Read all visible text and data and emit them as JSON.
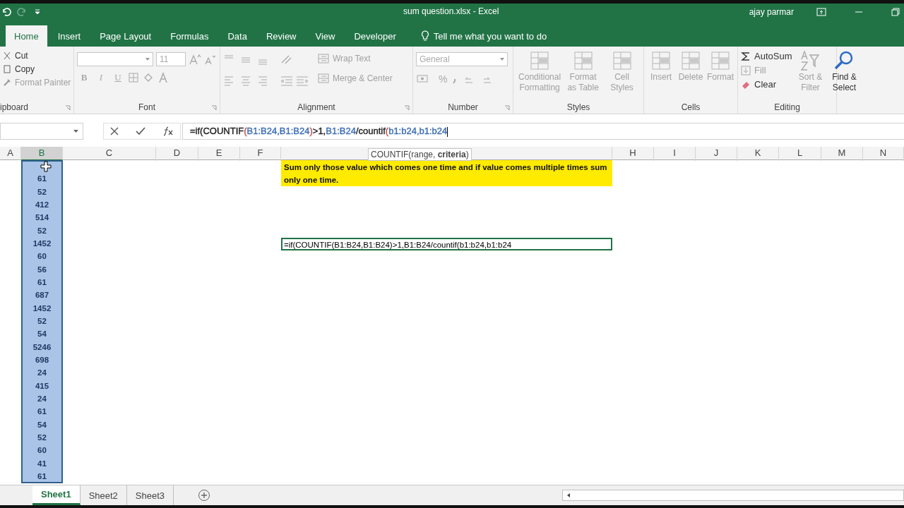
{
  "window": {
    "title": "sum question.xlsx  -  Excel",
    "user": "ajay parmar"
  },
  "ribbon_tabs": [
    {
      "label": "Home",
      "selected": true
    },
    {
      "label": "Insert",
      "selected": false
    },
    {
      "label": "Page Layout",
      "selected": false
    },
    {
      "label": "Formulas",
      "selected": false
    },
    {
      "label": "Data",
      "selected": false
    },
    {
      "label": "Review",
      "selected": false
    },
    {
      "label": "View",
      "selected": false
    },
    {
      "label": "Developer",
      "selected": false
    }
  ],
  "tell_me": "Tell me what you want to do",
  "ribbon": [
    {
      "kind": "clipboard",
      "label": "ipboard",
      "items": [
        {
          "label": "Cut",
          "disabled": false
        },
        {
          "label": "Copy",
          "disabled": false
        },
        {
          "label": "Format Painter",
          "disabled": true
        }
      ]
    },
    {
      "kind": "font",
      "label": "Font",
      "font_size": "11",
      "buttons": [
        "B",
        "I",
        "U"
      ],
      "disabled": true
    },
    {
      "kind": "alignment",
      "label": "Alignment",
      "items": [
        {
          "label": "Wrap Text",
          "disabled": true
        },
        {
          "label": "Merge & Center",
          "disabled": true
        }
      ]
    },
    {
      "kind": "number",
      "label": "Number",
      "format": "General",
      "percent": "%",
      "disabled": true
    },
    {
      "kind": "large",
      "label": "Styles",
      "items": [
        {
          "label": "Conditional Formatting",
          "disabled": true
        },
        {
          "label": "Format as Table",
          "disabled": true
        },
        {
          "label": "Cell Styles",
          "disabled": true
        }
      ]
    },
    {
      "kind": "large",
      "label": "Cells",
      "items": [
        {
          "label": "Insert",
          "disabled": true
        },
        {
          "label": "Delete",
          "disabled": true
        },
        {
          "label": "Format",
          "disabled": true
        }
      ]
    },
    {
      "kind": "editing",
      "label": "Editing",
      "items": [
        {
          "label": "AutoSum",
          "disabled": false
        },
        {
          "label": "Fill",
          "disabled": true
        },
        {
          "label": "Clear",
          "disabled": false
        }
      ],
      "large": [
        {
          "label": "Sort & Filter",
          "disabled": true
        },
        {
          "label": "Find & Select",
          "disabled": false
        }
      ]
    }
  ],
  "formula": [
    {
      "text": "=if(COUNTIF",
      "color": "#222222"
    },
    {
      "text": "(",
      "color": "#c0504d"
    },
    {
      "text": "B1:B24,B1:B24",
      "color": "#3f6fb5"
    },
    {
      "text": ")",
      "color": "#c0504d"
    },
    {
      "text": ">1,",
      "color": "#222222"
    },
    {
      "text": "B1:B24",
      "color": "#3f6fb5"
    },
    {
      "text": "/countif",
      "color": "#222222"
    },
    {
      "text": "(",
      "color": "#c0504d"
    },
    {
      "text": "b1:b24,b1:b24",
      "color": "#3f6fb5"
    }
  ],
  "tooltip": "COUNTIF(range, **criteria**)",
  "columns": [
    {
      "label": "A",
      "selected": false
    },
    {
      "label": "B",
      "selected": true
    },
    {
      "label": "C",
      "selected": false
    },
    {
      "label": "D",
      "selected": false
    },
    {
      "label": "E",
      "selected": false
    },
    {
      "label": "F",
      "selected": false
    },
    {
      "selected": false
    },
    {
      "label": "H",
      "selected": false
    },
    {
      "label": "I",
      "selected": false
    },
    {
      "label": "J",
      "selected": false
    },
    {
      "label": "K",
      "selected": false
    },
    {
      "label": "L",
      "selected": false
    },
    {
      "label": "M",
      "selected": false
    },
    {
      "label": "N",
      "selected": false
    }
  ],
  "column_b_values": [
    "61",
    "52",
    "412",
    "514",
    "52",
    "1452",
    "60",
    "56",
    "61",
    "687",
    "1452",
    "52",
    "54",
    "5246",
    "698",
    "24",
    "415",
    "24",
    "61",
    "54",
    "52",
    "60",
    "41",
    "61"
  ],
  "note": "Sum only those value which comes one time and if value comes multiple times sum only one time.",
  "edit_cell": "=if(COUNTIF(B1:B24,B1:B24)>1,B1:B24/countif(b1:b24,b1:b24",
  "sheet_tabs": [
    {
      "label": "Sheet1",
      "selected": true
    },
    {
      "label": "Sheet2",
      "selected": false
    },
    {
      "label": "Sheet3",
      "selected": false
    }
  ]
}
